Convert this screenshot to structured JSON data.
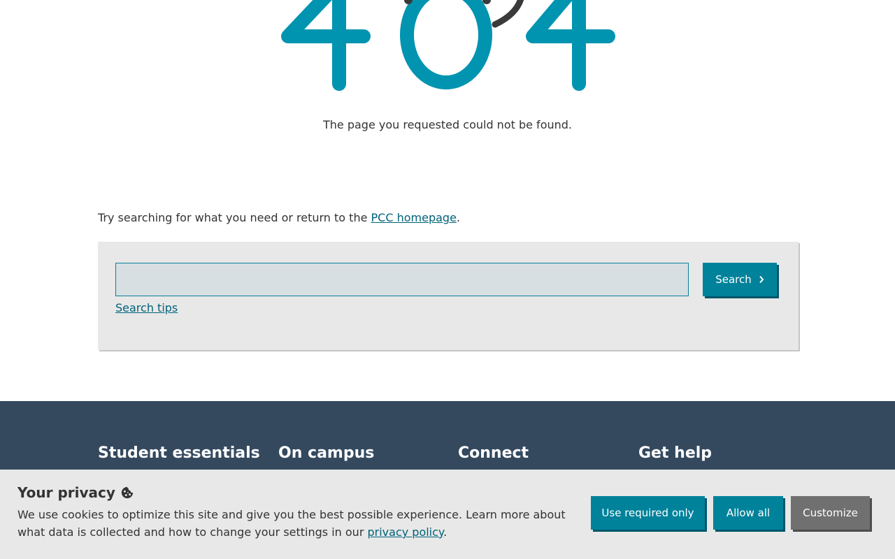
{
  "hero": {
    "code_text": "404"
  },
  "message": "The page you requested could not be found.",
  "try_line": {
    "prefix": "Try searching for what you need or return to the ",
    "link": "PCC homepage",
    "suffix": "."
  },
  "search": {
    "placeholder": "",
    "value": "",
    "button_label": "Search",
    "tips_label": "Search tips"
  },
  "footer": {
    "headings": [
      "Student essentials",
      "On campus",
      "Connect",
      "Get help"
    ]
  },
  "cookie": {
    "title": "Your privacy",
    "text_before": "We use cookies to optimize this site and give you the best possible experience. Learn more about what data is collected and how to change your settings in our ",
    "link": "privacy policy",
    "text_after": ".",
    "buttons": {
      "required_only": "Use required only",
      "allow_all": "Allow all",
      "customize": "Customize"
    }
  },
  "colors": {
    "accent": "#00829b",
    "footer_bg": "#34495e",
    "link": "#00637a"
  }
}
